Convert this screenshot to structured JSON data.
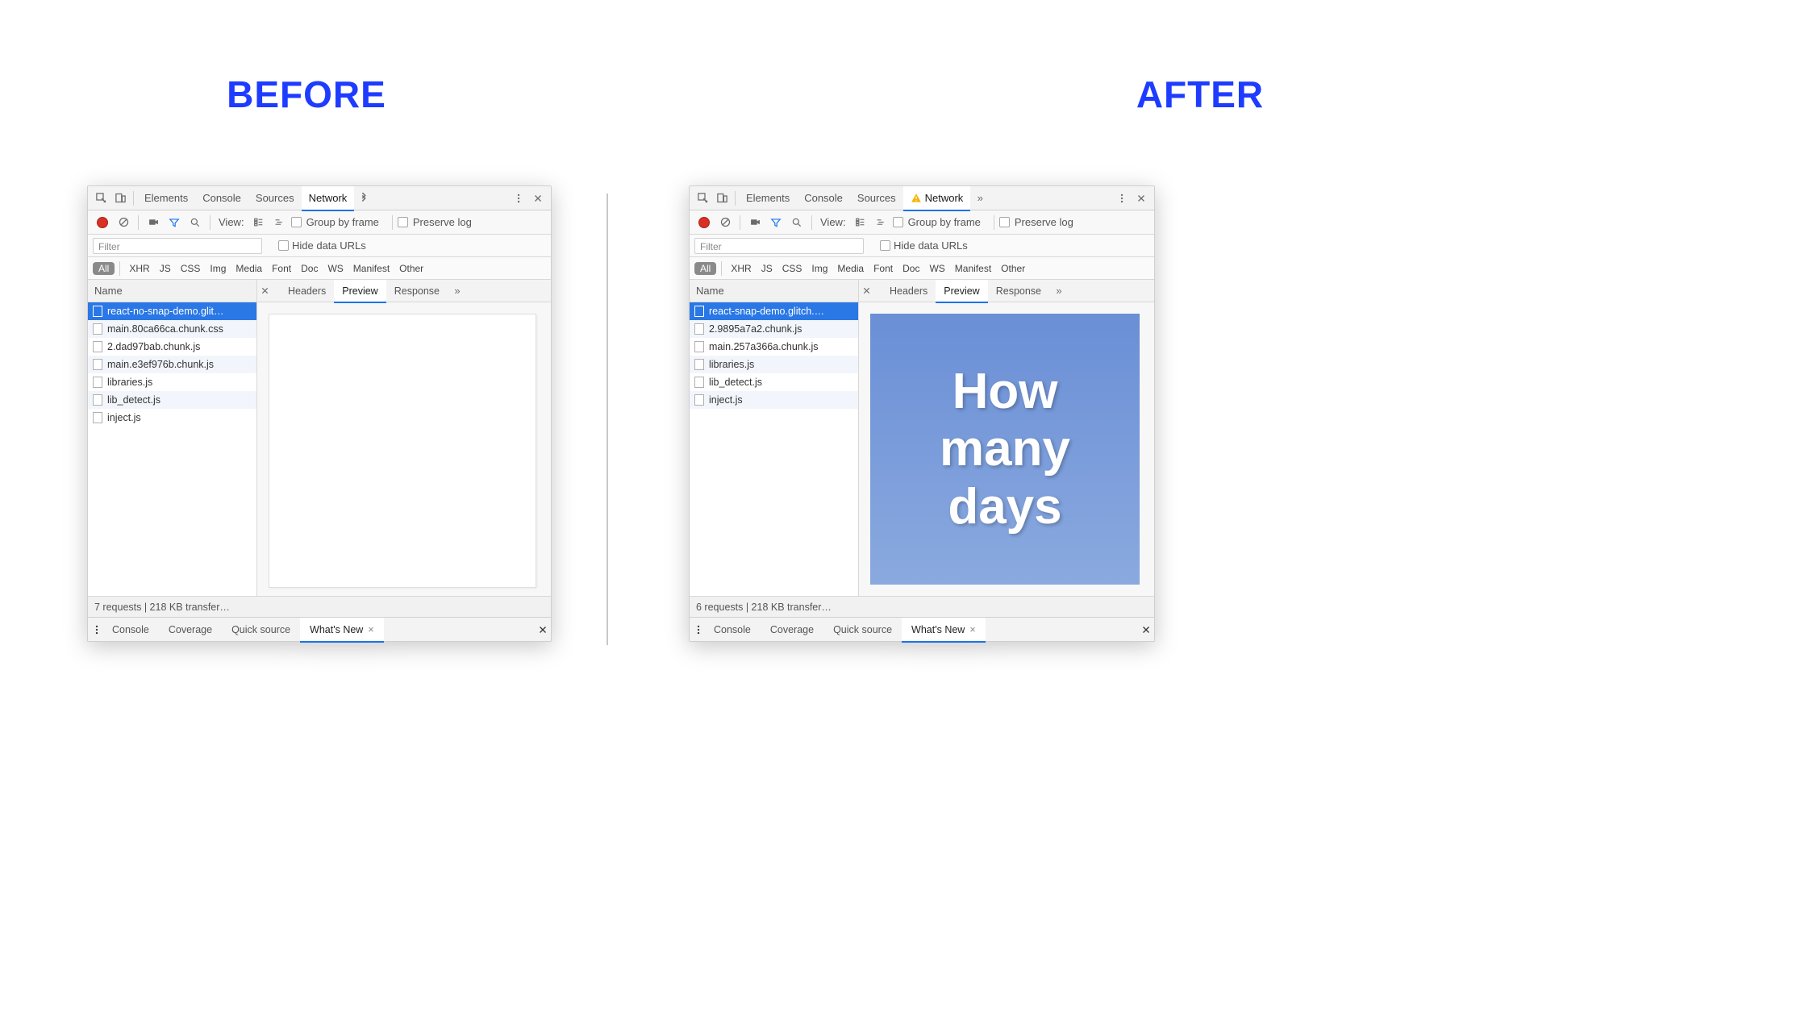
{
  "headings": {
    "before": "BEFORE",
    "after": "AFTER"
  },
  "tabs": {
    "elements": "Elements",
    "console": "Console",
    "sources": "Sources",
    "network": "Network"
  },
  "toolbar": {
    "view_label": "View:",
    "group_label": "Group by frame",
    "preserve_label": "Preserve log"
  },
  "filterbar": {
    "filter_placeholder": "Filter",
    "hide_urls": "Hide data URLs"
  },
  "types": {
    "all": "All",
    "xhr": "XHR",
    "js": "JS",
    "css": "CSS",
    "img": "Img",
    "media": "Media",
    "font": "Font",
    "doc": "Doc",
    "ws": "WS",
    "manifest": "Manifest",
    "other": "Other"
  },
  "columns": {
    "name": "Name"
  },
  "detail_tabs": {
    "headers": "Headers",
    "preview": "Preview",
    "response": "Response"
  },
  "drawer": {
    "console": "Console",
    "coverage": "Coverage",
    "quick_source": "Quick source",
    "whats_new": "What's New"
  },
  "before": {
    "requests": [
      {
        "name": "react-no-snap-demo.glit…",
        "selected": true
      },
      {
        "name": "main.80ca66ca.chunk.css"
      },
      {
        "name": "2.dad97bab.chunk.js"
      },
      {
        "name": "main.e3ef976b.chunk.js"
      },
      {
        "name": "libraries.js"
      },
      {
        "name": "lib_detect.js"
      },
      {
        "name": "inject.js"
      }
    ],
    "status": "7 requests | 218 KB transfer…"
  },
  "after": {
    "requests": [
      {
        "name": "react-snap-demo.glitch.…",
        "selected": true
      },
      {
        "name": "2.9895a7a2.chunk.js"
      },
      {
        "name": "main.257a366a.chunk.js"
      },
      {
        "name": "libraries.js"
      },
      {
        "name": "lib_detect.js"
      },
      {
        "name": "inject.js"
      }
    ],
    "status": "6 requests | 218 KB transfer…",
    "preview": {
      "line1": "How",
      "line2": "many",
      "line3": "days"
    }
  }
}
